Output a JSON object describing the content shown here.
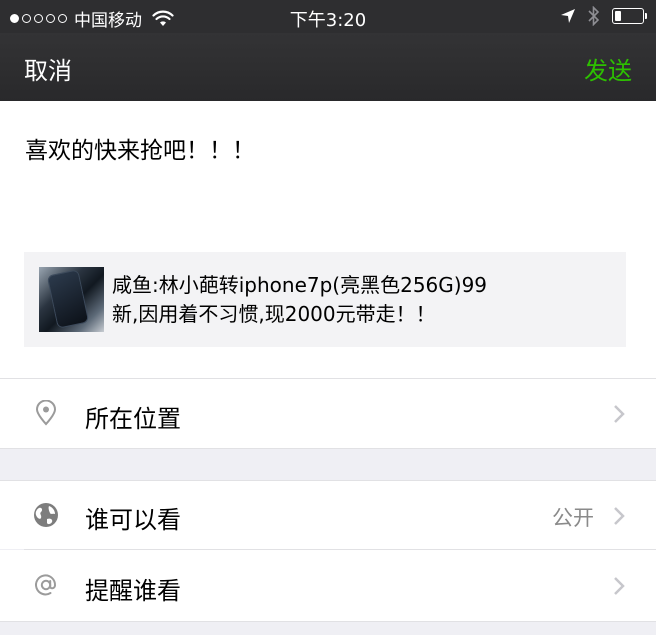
{
  "status": {
    "carrier": "中国移动",
    "time": "下午3:20",
    "signal_dots_filled": 1,
    "signal_dots_total": 5,
    "battery_level": 0.25
  },
  "nav": {
    "cancel_label": "取消",
    "send_label": "发送",
    "send_color": "#2dc100"
  },
  "compose": {
    "text": "喜欢的快来抢吧！！！",
    "share_card": {
      "line1": "咸鱼:林小葩转iphone7p(亮黑色256G)99",
      "line2": "新,因用着不习惯,现2000元带走！！"
    }
  },
  "options": {
    "location": {
      "label": "所在位置",
      "icon": "location-pin-icon"
    },
    "visibility": {
      "label": "谁可以看",
      "value": "公开",
      "icon": "globe-icon"
    },
    "remind": {
      "label": "提醒谁看",
      "icon": "at-icon"
    }
  }
}
